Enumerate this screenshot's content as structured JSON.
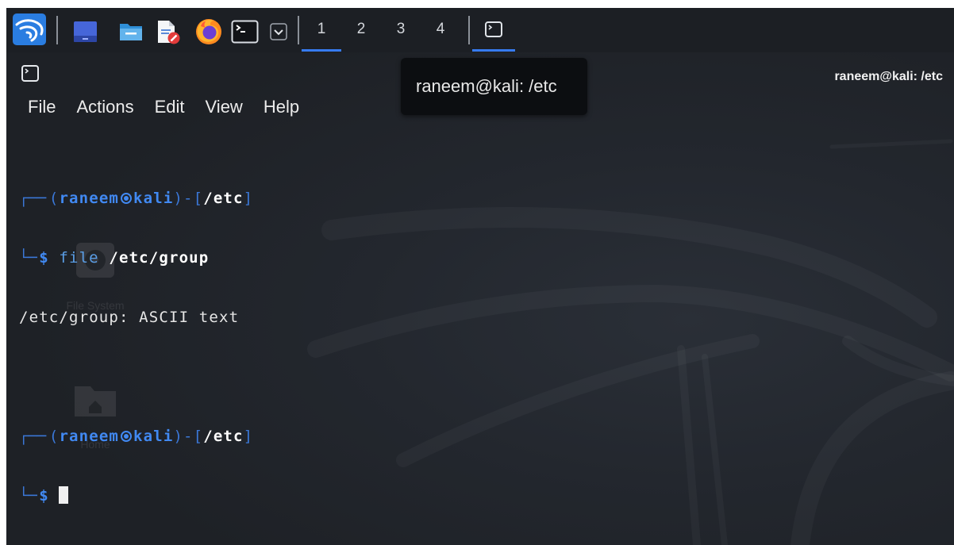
{
  "taskbar": {
    "launchers": [
      {
        "id": "kali-menu",
        "icon": "kali-dragon-icon"
      },
      {
        "id": "show-desktop",
        "icon": "show-desktop-icon"
      },
      {
        "id": "file-manager",
        "icon": "folder-icon"
      },
      {
        "id": "text-editor",
        "icon": "text-editor-icon"
      },
      {
        "id": "firefox",
        "icon": "firefox-icon"
      },
      {
        "id": "terminal",
        "icon": "terminal-icon"
      },
      {
        "id": "launcher-menu",
        "icon": "chevron-down-icon"
      }
    ],
    "workspaces": [
      "1",
      "2",
      "3",
      "4"
    ],
    "active_workspace": "1",
    "tasks": [
      {
        "icon": "terminal-window-icon",
        "active": true
      }
    ]
  },
  "window": {
    "icon": "terminal-window-icon",
    "title": "raneem@kali: /etc",
    "tooltip": "raneem@kali: /etc"
  },
  "menu": {
    "items": [
      "File",
      "Actions",
      "Edit",
      "View",
      "Help"
    ]
  },
  "terminal": {
    "prompt": {
      "corner_top": "┌──",
      "open": "(",
      "user": "raneem",
      "at": "㉿",
      "host": "kali",
      "mid": ")-[",
      "cwd": "/etc",
      "close": "]",
      "corner_bottom": "└─",
      "symbol": "$"
    },
    "entries": [
      {
        "command": "file",
        "argument": "/etc/group",
        "output": "/etc/group: ASCII text"
      }
    ],
    "current_input": ""
  },
  "desktop": {
    "icons": [
      {
        "label": "File System",
        "icon": "drive-icon"
      },
      {
        "label": "Home",
        "icon": "home-folder-icon"
      }
    ]
  },
  "colors": {
    "accent": "#367bf0",
    "prompt": "#4189f2",
    "command": "#5a9ee6",
    "text": "#e6e6e6",
    "tooltip": "#0c0e11"
  }
}
